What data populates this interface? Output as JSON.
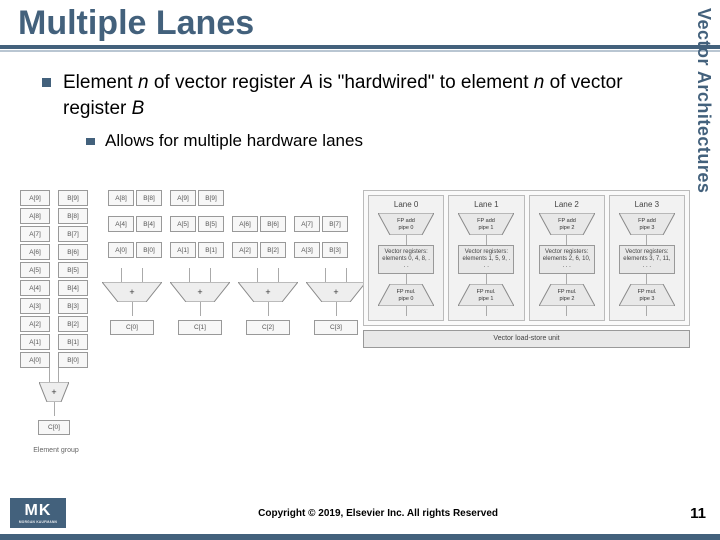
{
  "title": "Multiple Lanes",
  "side_label": "Vector Architectures",
  "bullets": {
    "b1_pre": "Element ",
    "b1_n1": "n",
    "b1_mid1": " of vector register ",
    "b1_A": "A",
    "b1_mid2": " is \"hardwired\" to element ",
    "b1_n2": "n",
    "b1_mid3": " of vector register ",
    "b1_B": "B",
    "b2": "Allows for multiple hardware lanes"
  },
  "left_fig": {
    "colA": [
      "A[9]",
      "A[8]",
      "A[7]",
      "A[6]",
      "A[5]",
      "A[4]",
      "A[3]",
      "A[2]",
      "A[1]",
      "A[0]"
    ],
    "colB": [
      "B[9]",
      "B[8]",
      "B[7]",
      "B[6]",
      "B[5]",
      "B[4]",
      "B[3]",
      "B[2]",
      "B[1]",
      "B[0]"
    ],
    "plus": "+",
    "c0": "C[0]",
    "pairs": [
      [
        "A[8]",
        "B[8]",
        "A[9]",
        "B[9]"
      ],
      [
        "A[4]",
        "B[4]",
        "A[5]",
        "B[5]",
        "A[6]",
        "B[6]",
        "A[7]",
        "B[7]"
      ],
      [
        "A[0]",
        "B[0]",
        "A[1]",
        "B[1]",
        "A[2]",
        "B[2]",
        "A[3]",
        "B[3]"
      ]
    ],
    "results": [
      "C[0]",
      "C[1]",
      "C[2]",
      "C[3]"
    ],
    "eg_label": "Element group"
  },
  "right_fig": {
    "lanes": [
      {
        "title": "Lane 0",
        "add": "FP add pipe 0",
        "reg": "Vector registers: elements 0, 4, 8, . . .",
        "mul": "FP mul. pipe 0"
      },
      {
        "title": "Lane 1",
        "add": "FP add pipe 1",
        "reg": "Vector registers: elements 1, 5, 9, . . .",
        "mul": "FP mul. pipe 1"
      },
      {
        "title": "Lane 2",
        "add": "FP add pipe 2",
        "reg": "Vector registers: elements 2, 6, 10, . . .",
        "mul": "FP mul. pipe 2"
      },
      {
        "title": "Lane 3",
        "add": "FP add pipe 3",
        "reg": "Vector registers: elements 3, 7, 11, . . .",
        "mul": "FP mul. pipe 3"
      }
    ],
    "bus": "Vector load-store unit"
  },
  "footer": {
    "logo_big": "MK",
    "logo_small": "MORGAN KAUFMANN",
    "copyright": "Copyright © 2019, Elsevier Inc. All rights Reserved",
    "page": "11"
  }
}
